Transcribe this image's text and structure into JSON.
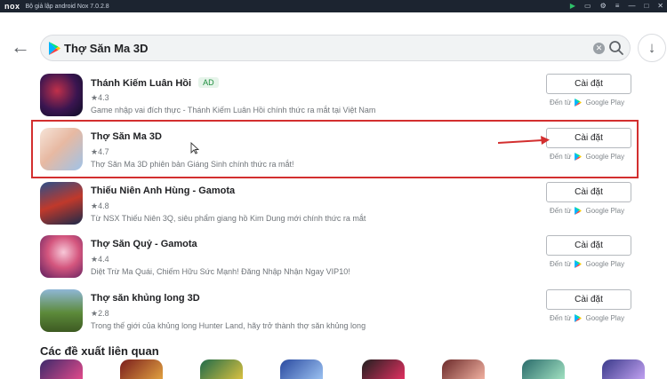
{
  "titlebar": {
    "logo": "nox",
    "title": "Bộ giả lập android Nox 7.0.2.8",
    "controls": [
      "▶",
      "▭",
      "⚙",
      "≡",
      "—",
      "□",
      "✕"
    ]
  },
  "search": {
    "query": "Thợ Săn Ma 3D"
  },
  "results": [
    {
      "name": "Thánh Kiếm Luân Hồi",
      "ad": "AD",
      "rating": "★4.3",
      "description": "Game nhập vai đích thực - Thánh Kiếm Luân Hồi chính thức ra mắt tại Việt Nam",
      "install": "Cài đặt",
      "from": "Đến từ",
      "store": "Google Play"
    },
    {
      "name": "Thợ Săn Ma 3D",
      "rating": "★4.7",
      "description": "Thợ Săn Ma 3D phiên bản Giáng Sinh chính thức ra mắt!",
      "install": "Cài đặt",
      "from": "Đến từ",
      "store": "Google Play"
    },
    {
      "name": "Thiếu Niên Anh Hùng - Gamota",
      "rating": "★4.8",
      "description": "Từ NSX Thiếu Niên 3Q, siêu phẩm giang hồ Kim Dung mới chính thức ra mắt",
      "install": "Cài đặt",
      "from": "Đến từ",
      "store": "Google Play"
    },
    {
      "name": "Thợ Săn Quỷ - Gamota",
      "rating": "★4.4",
      "description": "Diệt Trừ Ma Quái, Chiếm Hữu Sức Mạnh! Đăng Nhập Nhận Ngay VIP10!",
      "install": "Cài đặt",
      "from": "Đến từ",
      "store": "Google Play"
    },
    {
      "name": "Thợ săn khủng long 3D",
      "rating": "★2.8",
      "description": "Trong thế giới của khủng long Hunter Land, hãy trở thành thợ săn khủng long",
      "install": "Cài đặt",
      "from": "Đến từ",
      "store": "Google Play"
    }
  ],
  "related": {
    "title": "Các đề xuất liên quan"
  },
  "icons": {
    "back": "arrow-left-icon",
    "search": "search-icon",
    "clear": "clear-icon",
    "download": "download-icon",
    "play_store": "google-play-icon"
  },
  "colors": {
    "highlight": "#d32f2f",
    "titlebar": "#1c2430",
    "ad_badge": "#1e8e3e"
  }
}
